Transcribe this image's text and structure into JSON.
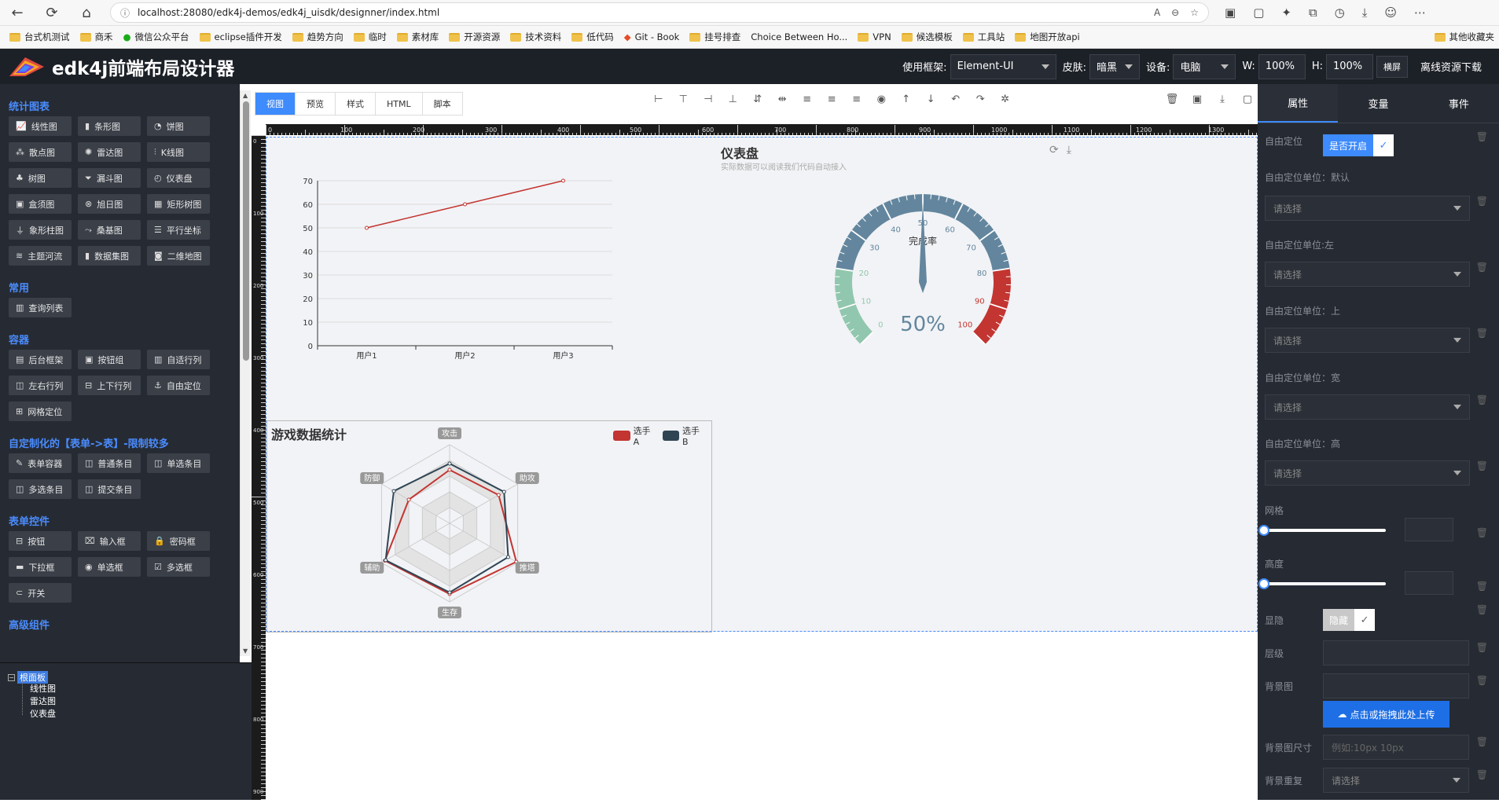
{
  "browser": {
    "url": "localhost:28080/edk4j-demos/edk4j_uisdk/designner/index.html",
    "bookmarks": [
      "台式机测试",
      "商禾",
      "微信公众平台",
      "eclipse插件开发",
      "趋势方向",
      "临时",
      "素材库",
      "开源资源",
      "技术资料",
      "低代码",
      "Git - Book",
      "挂号排查",
      "Choice Between Ho...",
      "VPN",
      "候选模板",
      "工具站",
      "地图开放api"
    ],
    "other_bookmarks": "其他收藏夹"
  },
  "app": {
    "title": "edk4j前端布局设计器",
    "framework_label": "使用框架:",
    "framework_value": "Element-UI",
    "skin_label": "皮肤:",
    "skin_value": "暗黑",
    "device_label": "设备:",
    "device_value": "电脑",
    "w_label": "W:",
    "w_value": "100%",
    "h_label": "H:",
    "h_value": "100%",
    "fullscreen": "横屏",
    "offline": "离线资源下载"
  },
  "widgets": [
    {
      "title": "统计图表",
      "items": [
        {
          "label": "线性图",
          "icon": "📈"
        },
        {
          "label": "条形图",
          "icon": "▮"
        },
        {
          "label": "饼图",
          "icon": "◔"
        },
        {
          "label": "散点图",
          "icon": "⁂"
        },
        {
          "label": "雷达图",
          "icon": "✺"
        },
        {
          "label": "K线图",
          "icon": "⫶"
        },
        {
          "label": "树图",
          "icon": "♣"
        },
        {
          "label": "漏斗图",
          "icon": "⏷"
        },
        {
          "label": "仪表盘",
          "icon": "◴"
        },
        {
          "label": "盒须图",
          "icon": "▣"
        },
        {
          "label": "旭日图",
          "icon": "⊗"
        },
        {
          "label": "矩形树图",
          "icon": "▦"
        },
        {
          "label": "象形柱图",
          "icon": "⏚"
        },
        {
          "label": "桑基图",
          "icon": "⤳"
        },
        {
          "label": "平行坐标",
          "icon": "☰"
        },
        {
          "label": "主题河流",
          "icon": "≋"
        },
        {
          "label": "数据集图",
          "icon": "▮"
        },
        {
          "label": "二维地图",
          "icon": "◙"
        }
      ]
    },
    {
      "title": "常用",
      "items": [
        {
          "label": "查询列表",
          "icon": "▥"
        }
      ]
    },
    {
      "title": "容器",
      "items": [
        {
          "label": "后台框架",
          "icon": "▤"
        },
        {
          "label": "按钮组",
          "icon": "▣"
        },
        {
          "label": "自适行列",
          "icon": "▥"
        },
        {
          "label": "左右行列",
          "icon": "◫"
        },
        {
          "label": "上下行列",
          "icon": "⊟"
        },
        {
          "label": "自由定位",
          "icon": "⚓"
        },
        {
          "label": "网格定位",
          "icon": "⊞"
        }
      ]
    },
    {
      "title": "自定制化的【表单->表】-限制较多",
      "items": [
        {
          "label": "表单容器",
          "icon": "✎"
        },
        {
          "label": "普通条目",
          "icon": "◫"
        },
        {
          "label": "单选条目",
          "icon": "◫"
        },
        {
          "label": "多选条目",
          "icon": "◫"
        },
        {
          "label": "提交条目",
          "icon": "◫"
        }
      ]
    },
    {
      "title": "表单控件",
      "items": [
        {
          "label": "按钮",
          "icon": "⊟"
        },
        {
          "label": "输入框",
          "icon": "⌧"
        },
        {
          "label": "密码框",
          "icon": "🔒"
        },
        {
          "label": "下拉框",
          "icon": "▬"
        },
        {
          "label": "单选框",
          "icon": "◉"
        },
        {
          "label": "多选框",
          "icon": "☑"
        },
        {
          "label": "开关",
          "icon": "⊂"
        }
      ]
    },
    {
      "title": "高级组件",
      "items": []
    }
  ],
  "tree": {
    "root": "根面板",
    "children": [
      "线性图",
      "雷达图",
      "仪表盘"
    ]
  },
  "canvas_tabs": [
    "视图",
    "预览",
    "样式",
    "HTML",
    "脚本"
  ],
  "ruler_labels": [
    "0",
    "100",
    "200",
    "300",
    "400",
    "500",
    "600",
    "700",
    "800",
    "900",
    "1000",
    "1100",
    "1200",
    "1300"
  ],
  "ruler_v_labels": [
    "0",
    "100",
    "200",
    "300",
    "400",
    "500",
    "600",
    "700",
    "800",
    "900"
  ],
  "line_chart": {
    "chart_data": {
      "type": "line",
      "categories": [
        "用户1",
        "用户2",
        "用户3"
      ],
      "values": [
        50,
        60,
        70
      ],
      "ylim": [
        0,
        70
      ],
      "yticks": [
        0,
        10,
        20,
        30,
        40,
        50,
        60,
        70
      ],
      "color": "#c23531"
    }
  },
  "gauge": {
    "title": "仪表盘",
    "subtitle": "实际数据可以阅读我们代码自动接入",
    "name": "完成率",
    "value": 50,
    "value_text": "50%",
    "ticks": [
      "0",
      "10",
      "20",
      "30",
      "40",
      "50",
      "60",
      "70",
      "80",
      "90",
      "100"
    ],
    "colors": {
      "low": "#91c7ae",
      "mid": "#63869e",
      "high": "#c23531"
    }
  },
  "radar": {
    "title": "游戏数据统计",
    "indicators": [
      "攻击",
      "助攻",
      "推塔",
      "生存",
      "辅助",
      "防御"
    ],
    "series": [
      {
        "name": "选手A",
        "color": "#c23531",
        "values": [
          0.68,
          0.72,
          0.98,
          0.9,
          0.95,
          0.6
        ]
      },
      {
        "name": "选手B",
        "color": "#2f4554",
        "values": [
          0.76,
          0.8,
          0.86,
          0.88,
          0.94,
          0.82
        ]
      }
    ]
  },
  "props": {
    "tabs": [
      "属性",
      "变量",
      "事件"
    ],
    "free_pos_label": "自由定位",
    "free_pos_toggle": "是否开启",
    "unit_default": "自由定位单位：默认",
    "unit_left": "自由定位单位:左",
    "unit_top": "自由定位单位：上",
    "unit_width": "自由定位单位：宽",
    "unit_height": "自由定位单位：高",
    "select_placeholder": "请选择",
    "grid_label": "网格",
    "height_label": "高度",
    "visible_label": "显隐",
    "visible_toggle": "隐藏",
    "zindex_label": "层级",
    "bg_label": "背景图",
    "upload_label": "点击或拖拽此处上传",
    "bg_size_label": "背景图尺寸",
    "bg_size_placeholder": "例如:10px 10px",
    "bg_repeat_label": "背景重复",
    "grid_value": 0,
    "height_value": 0
  }
}
